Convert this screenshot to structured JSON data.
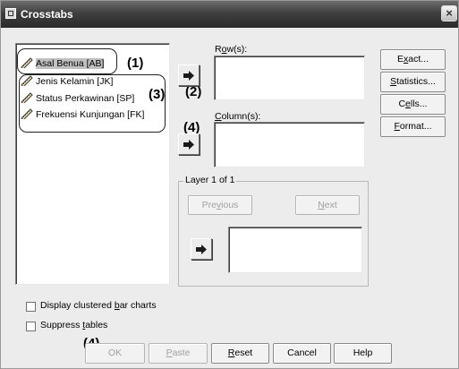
{
  "window": {
    "title": "Crosstabs",
    "close_glyph": "×"
  },
  "variables": [
    {
      "label": "Asal Benua [AB]",
      "icon": "ruler-pencil-icon",
      "selected": true
    },
    {
      "label": "Jenis Kelamin [JK]",
      "icon": "ruler-pencil-icon",
      "selected": false
    },
    {
      "label": "Status Perkawinan [SP]",
      "icon": "ruler-pencil-icon",
      "selected": false
    },
    {
      "label": "Frekuensi Kunjungan [FK]",
      "icon": "ruler-pencil-icon",
      "selected": false
    }
  ],
  "rows": {
    "label_pre": "R",
    "label_mn": "o",
    "label_post": "w(s):"
  },
  "columns": {
    "label_pre": "",
    "label_mn": "C",
    "label_post": "olumn(s):"
  },
  "layer": {
    "legend": "Layer 1 of 1",
    "previous_pre": "Pre",
    "previous_mn": "v",
    "previous_post": "ious",
    "next_pre": "",
    "next_mn": "N",
    "next_post": "ext"
  },
  "side_buttons": [
    {
      "pre": "E",
      "mn": "x",
      "post": "act..."
    },
    {
      "pre": "",
      "mn": "S",
      "post": "tatistics..."
    },
    {
      "pre": "C",
      "mn": "e",
      "post": "lls..."
    },
    {
      "pre": "",
      "mn": "F",
      "post": "ormat..."
    }
  ],
  "options": {
    "clustered_pre": "Display clustered ",
    "clustered_mn": "b",
    "clustered_post": "ar charts",
    "suppress_pre": "Suppress ",
    "suppress_mn": "t",
    "suppress_post": "ables"
  },
  "bottom_buttons": {
    "ok": "OK",
    "paste_pre": "",
    "paste_mn": "P",
    "paste_post": "aste",
    "reset_pre": "",
    "reset_mn": "R",
    "reset_post": "eset",
    "cancel": "Cancel",
    "help": "Help"
  },
  "annotations": {
    "a1": "(1)",
    "a2": "(2)",
    "a3": "(3)",
    "a4_column": "(4)",
    "a4_ok": "(4)"
  },
  "colors": {
    "titlebar": "#3f3f3f",
    "dialog_bg": "#ececec",
    "arrow": "#1a1a1a"
  }
}
